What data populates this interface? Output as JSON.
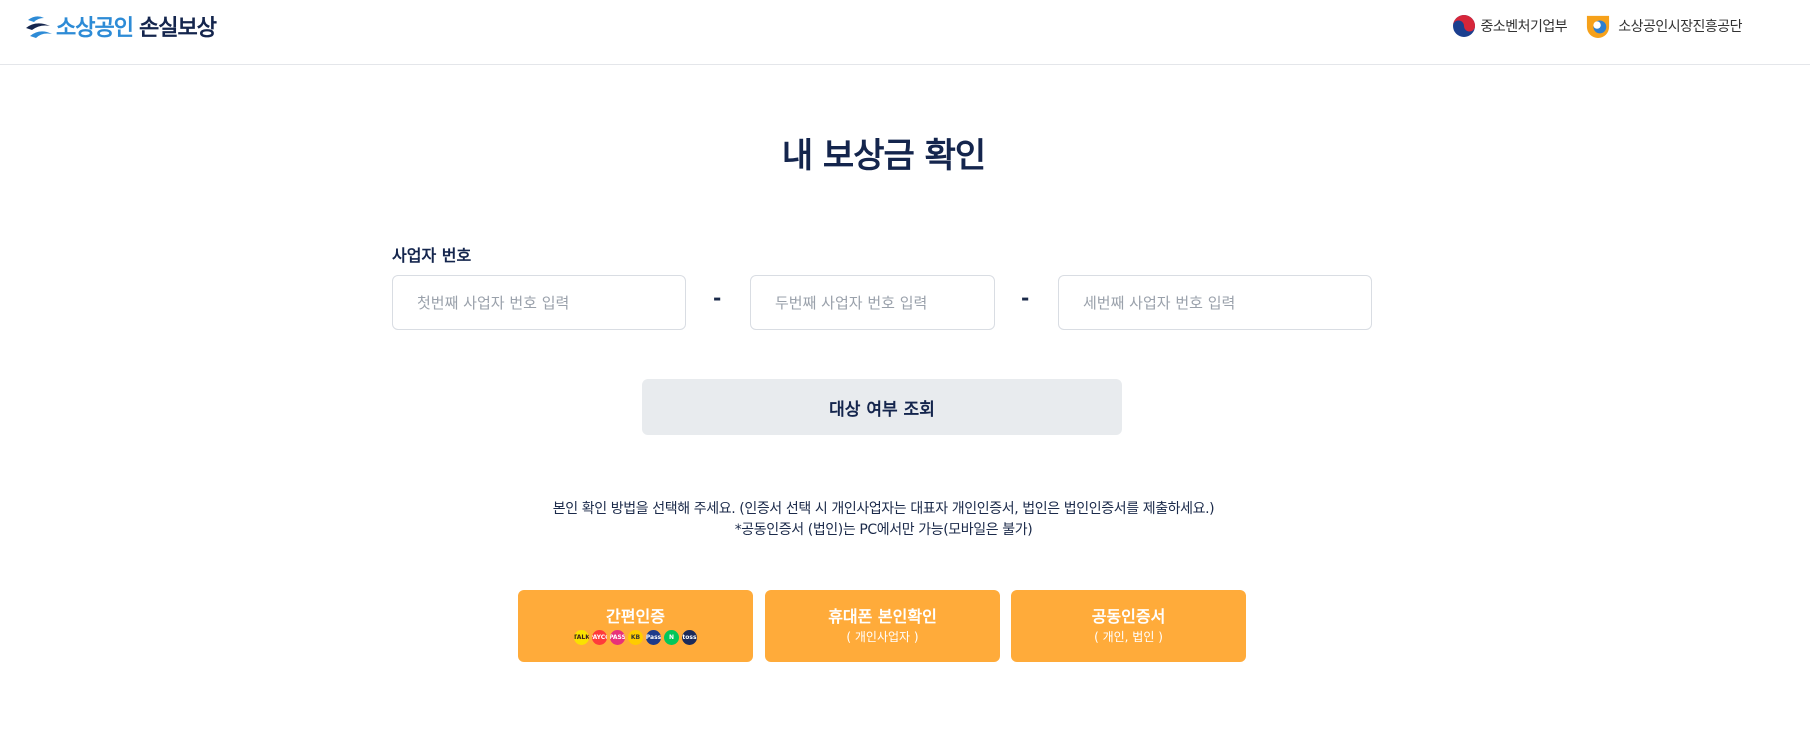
{
  "header": {
    "logo_part1": "소상공인",
    "logo_part2": "손실보상",
    "orgs": [
      {
        "name": "중소벤처기업부",
        "icon": "taegeuk-icon"
      },
      {
        "name": "소상공인시장진흥공단",
        "icon": "semas-logo-icon"
      }
    ]
  },
  "page": {
    "title": "내 보상금 확인"
  },
  "business_number": {
    "label": "사업자 번호",
    "part1_placeholder": "첫번째 사업자 번호 입력",
    "part2_placeholder": "두번째 사업자 번호 입력",
    "part3_placeholder": "세번째 사업자 번호 입력",
    "separator": "-"
  },
  "check_button_label": "대상 여부 조회",
  "notice": {
    "line1": "본인 확인 방법을 선택해 주세요. (인증서 선택 시 개인사업자는 대표자 개인인증서, 법인은 법인인증서를 제출하세요.)",
    "line2": "*공동인증서 (법인)는 PC에서만 가능(모바일은 불가)"
  },
  "auth_methods": [
    {
      "label": "간편인증",
      "sub": ""
    },
    {
      "label": "휴대폰 본인확인",
      "sub": "( 개인사업자 )"
    },
    {
      "label": "공동인증서",
      "sub": "( 개인, 법인 )"
    }
  ],
  "simple_auth_providers": [
    {
      "icon": "kakao-icon",
      "text": "TALK",
      "color": "#fae100",
      "text_color": "#3c1e1e"
    },
    {
      "icon": "payco-icon",
      "text": "PAYCO",
      "color": "#ff3b3b",
      "text_color": "#ffffff"
    },
    {
      "icon": "pass-icon",
      "text": "PASS",
      "color": "#e8317a",
      "text_color": "#ffffff"
    },
    {
      "icon": "kb-icon",
      "text": "KB",
      "color": "#ffcc00",
      "text_color": "#333333"
    },
    {
      "icon": "samsung-pass-icon",
      "text": "Pass",
      "color": "#1d3a8a",
      "text_color": "#ffffff"
    },
    {
      "icon": "naver-icon",
      "text": "N",
      "color": "#03c75a",
      "text_color": "#ffffff"
    },
    {
      "icon": "toss-icon",
      "text": "toss",
      "color": "#1c2b5a",
      "text_color": "#ffffff"
    }
  ]
}
